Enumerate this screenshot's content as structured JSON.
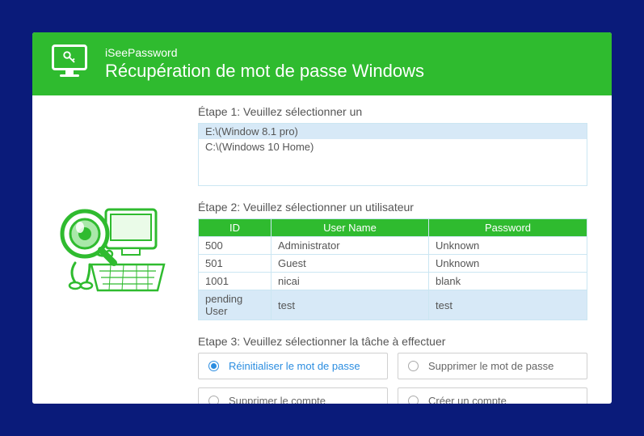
{
  "header": {
    "brand": "iSeePassword",
    "title": "Récupération de mot de passe Windows"
  },
  "step1": {
    "label": "Étape 1: Veuillez sélectionner un",
    "items": [
      {
        "text": "E:\\(Window 8.1 pro)",
        "selected": true
      },
      {
        "text": "C:\\(Windows 10 Home)",
        "selected": false
      }
    ]
  },
  "step2": {
    "label": "Étape 2: Veuillez sélectionner un utilisateur",
    "headers": {
      "id": "ID",
      "name": "User Name",
      "pwd": "Password"
    },
    "rows": [
      {
        "id": "500",
        "name": "Administrator",
        "pwd": "Unknown",
        "selected": false
      },
      {
        "id": "501",
        "name": "Guest",
        "pwd": "Unknown",
        "selected": false
      },
      {
        "id": "1001",
        "name": "nicai",
        "pwd": "blank",
        "selected": false
      },
      {
        "id": "pending User",
        "name": "test",
        "pwd": "test",
        "selected": true
      }
    ]
  },
  "step3": {
    "label": "Etape 3: Veuillez sélectionner la tâche à effectuer",
    "options": [
      {
        "label": "Réinitialiser le mot de passe",
        "checked": true
      },
      {
        "label": "Supprimer le mot de passe",
        "checked": false
      },
      {
        "label": "Supprimer le compte",
        "checked": false
      },
      {
        "label": "Créer un compte",
        "checked": false
      }
    ]
  }
}
